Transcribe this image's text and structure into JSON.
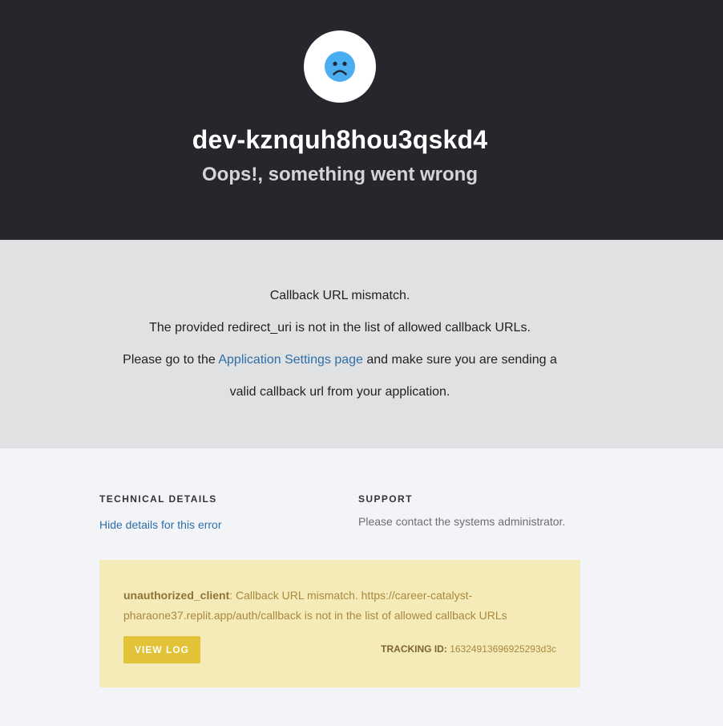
{
  "header": {
    "tenant_name": "dev-kznquh8hou3qskd4",
    "subtitle": "Oops!, something went wrong",
    "icon": "sad-face-icon"
  },
  "message": {
    "line1": "Callback URL mismatch.",
    "line2": "The provided redirect_uri is not in the list of allowed callback URLs.",
    "line3_before": "Please go to the ",
    "line3_link": "Application Settings page",
    "line3_after": " and make sure you are sending a",
    "line4": "valid callback url from your application."
  },
  "technical_details": {
    "heading": "TECHNICAL DETAILS",
    "toggle_link": "Hide details for this error"
  },
  "support": {
    "heading": "SUPPORT",
    "text": "Please contact the systems administrator."
  },
  "error": {
    "code": "unauthorized_client",
    "separator": ": ",
    "description": "Callback URL mismatch. https://career-catalyst-pharaone37.replit.app/auth/callback is not in the list of allowed callback URLs",
    "view_log_label": "VIEW LOG",
    "tracking_label": "TRACKING ID:",
    "tracking_id": "16324913696925293d3c"
  },
  "colors": {
    "header_bg": "#26272c",
    "message_bg": "#e0e1e3",
    "page_bg": "#f2f4f8",
    "link": "#2f6ea6",
    "error_box_bg": "#f5ebb8",
    "button_bg": "#e2c236",
    "sad_face": "#4aaef0"
  }
}
